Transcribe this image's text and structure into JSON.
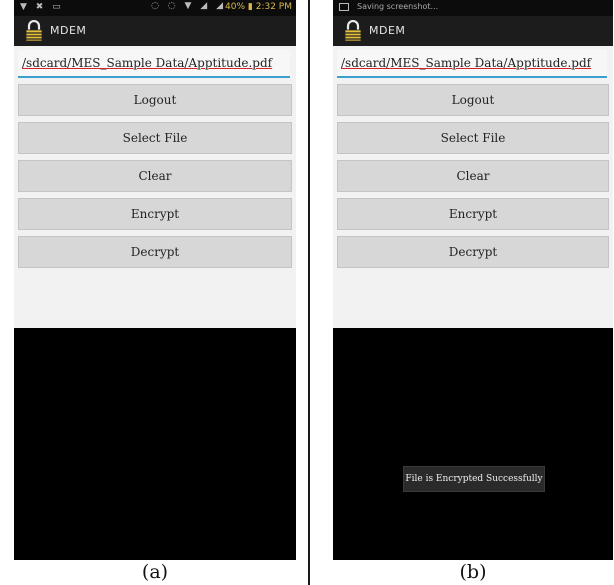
{
  "panels": {
    "a": {
      "caption": "(a)",
      "status_time": "2:32 PM",
      "status_battery": "40%",
      "app_title": "MDEM",
      "file_path": "/sdcard/MES_Sample Data/Apptitude.pdf",
      "buttons": [
        "Logout",
        "Select File",
        "Clear",
        "Encrypt",
        "Decrypt"
      ]
    },
    "b": {
      "caption": "(b)",
      "status_notice": "Saving screenshot...",
      "app_title": "MDEM",
      "file_path": "/sdcard/MES_Sample Data/Apptitude.pdf",
      "buttons": [
        "Logout",
        "Select File",
        "Clear",
        "Encrypt",
        "Decrypt"
      ],
      "toast": "File is Encrypted Successfully"
    }
  },
  "colors": {
    "accent_underline": "#3aa0cc",
    "spell_underline": "#d2232a",
    "button_bg": "#d7d7d7",
    "screen_bg": "#000000"
  },
  "icons": [
    "lock-icon",
    "bluetooth-icon",
    "signal-icon",
    "battery-icon",
    "screenshot-icon"
  ]
}
